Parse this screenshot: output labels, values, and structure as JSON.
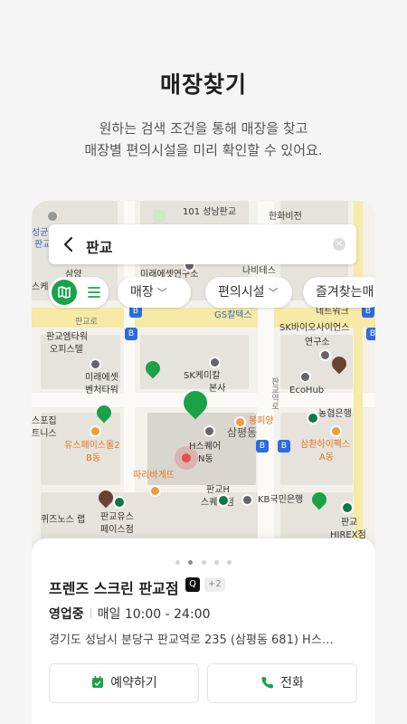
{
  "intro": {
    "title": "매장찾기",
    "line1": "원하는 검색 조건을 통해 매장을 찾고",
    "line2": "매장별 편의시설을 미리 확인할 수 있어요."
  },
  "search": {
    "query": "판교"
  },
  "filters": {
    "chips": [
      "매장",
      "편의시설",
      "즐겨찾는매"
    ]
  },
  "map_labels": {
    "l1": "101 성남판교",
    "l2": "한화비전",
    "l3": "성균",
    "l4": "판교",
    "l5": "삼양",
    "l6": "미래에셋연구소",
    "l7": "나비테스",
    "l8": "판교로",
    "l9": "GS칼텍스",
    "l10": "네트워크",
    "l11": "SK바이오사이언스",
    "l12": "연구소",
    "l13": "판교엠타워",
    "l14": "오피스텔",
    "l15": "미래에셋",
    "l16": "벤처타워",
    "l17": "SK케미칼",
    "l18": "본사",
    "l19": "판교역로",
    "l20": "EcoHub",
    "l21": "스포집",
    "l22": "트니스",
    "l23": "유스페이스몰2",
    "l24": "B동",
    "l25": "봉피양",
    "l26": "삼평동",
    "l27": "농협은행",
    "l28": "H스퀘어",
    "l29": "N동",
    "l30": "삼환하이펙스",
    "l31": "A동",
    "l32": "파리바게뜨",
    "l33": "판교H",
    "l34": "스퀘어점",
    "l35": "KB국민은행",
    "l36": "퀴즈노스 랩",
    "l37": "판교유스",
    "l38": "페이스점",
    "l39": "판교",
    "l40": "HIREX점",
    "l41": "스케"
  },
  "store": {
    "name": "프렌즈 스크린 판교점",
    "badge_q": "Q",
    "badge_more": "+2",
    "status": "영업중",
    "hours": "매일 10:00 - 24:00",
    "address": "경기도 성남시 분당구 판교역로 235 (삼평동 681) H스…"
  },
  "actions": {
    "reserve": "예약하기",
    "call": "전화"
  },
  "pager": {
    "total": 5,
    "active": 1
  },
  "colors": {
    "brand_green": "#1aa248",
    "pin_brown": "#6b4334",
    "starbucks": "#11764a"
  }
}
